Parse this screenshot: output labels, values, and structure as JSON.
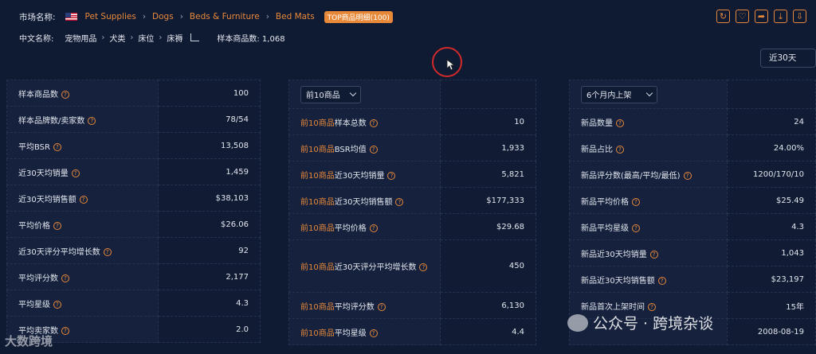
{
  "header": {
    "market_label": "市场名称:",
    "breadcrumbs": [
      "Pet Supplies",
      "Dogs",
      "Beds & Furniture",
      "Bed Mats"
    ],
    "top_badge": "TOP商品明细(100)",
    "cn_label": "中文名称:",
    "cn_breadcrumbs": [
      "宠物用品",
      "犬类",
      "床位",
      "床褥"
    ],
    "sample_count": "样本商品数: 1,068"
  },
  "toolbar_icons": [
    "refresh-icon",
    "heart-icon",
    "share-icon",
    "download-icon",
    "export-icon"
  ],
  "period_select": "近30天",
  "panel1": {
    "rows": [
      {
        "label": "样本商品数",
        "value": "100"
      },
      {
        "label": "样本品牌数/卖家数",
        "value": "78/54"
      },
      {
        "label": "平均BSR",
        "value": "13,508"
      },
      {
        "label": "近30天均销量",
        "value": "1,459"
      },
      {
        "label": "近30天均销售额",
        "value": "$38,103"
      },
      {
        "label": "平均价格",
        "value": "$26.06"
      },
      {
        "label": "近30天评分平均增长数",
        "value": "92"
      },
      {
        "label": "平均评分数",
        "value": "2,177"
      },
      {
        "label": "平均星级",
        "value": "4.3"
      },
      {
        "label": "平均卖家数",
        "value": "2.0"
      }
    ]
  },
  "panel2": {
    "select": "前10商品",
    "prefix": "前10商品",
    "rows": [
      {
        "label": "样本总数",
        "value": "10"
      },
      {
        "label": "BSR均值",
        "value": "1,933"
      },
      {
        "label": "近30天均销量",
        "value": "5,821"
      },
      {
        "label": "近30天均销售额",
        "value": "$177,333"
      },
      {
        "label": "平均价格",
        "value": "$29.68"
      },
      {
        "label": "近30天评分平均增长数",
        "value": "450"
      },
      {
        "label": "平均评分数",
        "value": "6,130"
      },
      {
        "label": "平均星级",
        "value": "4.4"
      }
    ]
  },
  "panel3": {
    "select": "6个月内上架",
    "rows": [
      {
        "label": "新品数量",
        "value": "24"
      },
      {
        "label": "新品占比",
        "value": "24.00%"
      },
      {
        "label": "新品评分数(最高/平均/最低)",
        "value": "1200/170/10"
      },
      {
        "label": "新品平均价格",
        "value": "$25.49"
      },
      {
        "label": "新品平均星级",
        "value": "4.3"
      },
      {
        "label": "新品近30天均销量",
        "value": "1,043"
      },
      {
        "label": "新品近30天均销售额",
        "value": "$23,197"
      },
      {
        "label": "新品首次上架时间",
        "value": "15年"
      },
      {
        "label": "",
        "value": "2008-08-19"
      }
    ]
  },
  "watermark_left": "大数跨境",
  "watermark_right": "公众号 · 跨境杂谈",
  "colors": {
    "accent": "#e8893a",
    "background": "#0f1a33"
  }
}
